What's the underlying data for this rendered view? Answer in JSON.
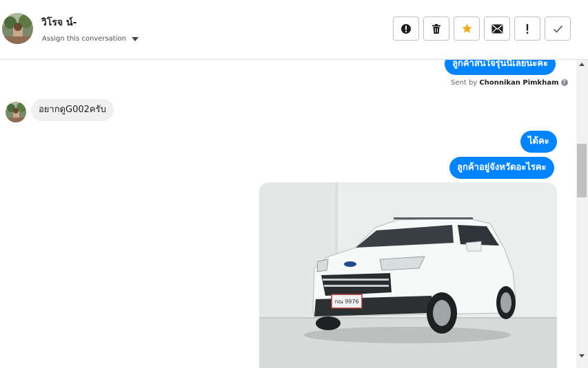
{
  "header": {
    "contact_name": "วิโรจ น์-",
    "assign_label": "Assign this conversation"
  },
  "actions": [
    {
      "name": "mark-spam-button",
      "icon": "alert-circle-icon"
    },
    {
      "name": "delete-button",
      "icon": "trash-icon"
    },
    {
      "name": "star-button",
      "icon": "star-icon"
    },
    {
      "name": "mark-unread-button",
      "icon": "envelope-icon"
    },
    {
      "name": "follow-up-button",
      "icon": "exclamation-icon"
    },
    {
      "name": "mark-done-button",
      "icon": "checkmark-icon"
    }
  ],
  "colors": {
    "accent": "#0084ff",
    "star": "#f5a623",
    "incoming_bubble": "#f1f0f0"
  },
  "messages": {
    "out_1": "ลูกค้าสนใจรุ่นนี้เลยนะคะ",
    "sent_by_prefix": "Sent by",
    "sent_by_name": "Chonnikan Pimkham",
    "in_1": "อยากดูG002ครับ",
    "out_2": "ได้คะ",
    "out_3": "ลูกค้าอยู่จังหวัดอะไรคะ"
  },
  "attachment": {
    "plate_text": "กณ 9976"
  }
}
